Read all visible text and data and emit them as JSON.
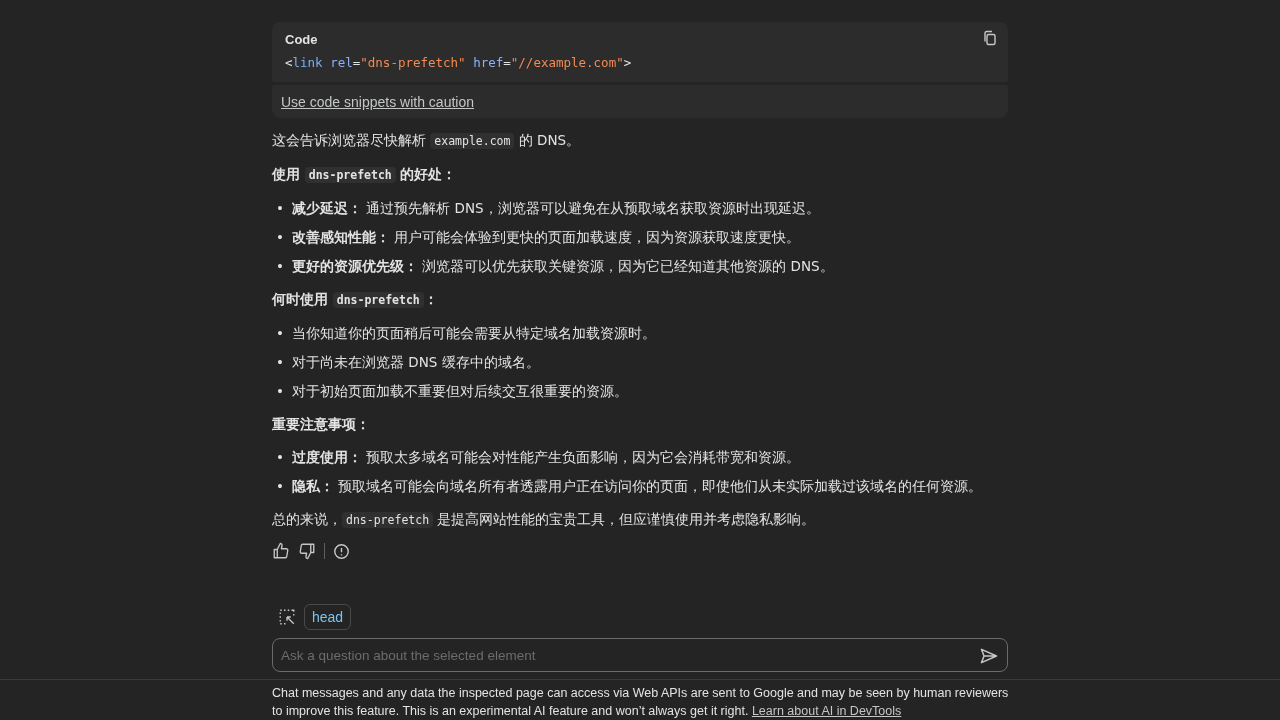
{
  "code_block": {
    "title": "Code",
    "tokens": [
      {
        "kind": "punct",
        "text": "<"
      },
      {
        "kind": "tag",
        "text": "link"
      },
      {
        "kind": "attr",
        "text": " rel"
      },
      {
        "kind": "punct",
        "text": "="
      },
      {
        "kind": "value",
        "text": "\"dns-prefetch\""
      },
      {
        "kind": "attr",
        "text": " href"
      },
      {
        "kind": "punct",
        "text": "="
      },
      {
        "kind": "value",
        "text": "\"//example.com\""
      },
      {
        "kind": "punct",
        "text": ">"
      }
    ],
    "caution_link": "Use code snippets with caution"
  },
  "bullet": "•",
  "blocks": [
    {
      "kind": "paragraph",
      "segments": [
        {
          "kind": "text",
          "text": "这会告诉浏览器尽快解析 "
        },
        {
          "kind": "code",
          "text": "example.com"
        },
        {
          "kind": "text",
          "text": " 的 DNS。"
        }
      ]
    },
    {
      "kind": "heading",
      "segments": [
        {
          "kind": "text",
          "text": "使用 "
        },
        {
          "kind": "code",
          "text": "dns-prefetch"
        },
        {
          "kind": "text",
          "text": " 的好处："
        }
      ]
    },
    {
      "kind": "list",
      "items": [
        [
          {
            "kind": "bold",
            "text": "减少延迟："
          },
          {
            "kind": "text",
            "text": " 通过预先解析 DNS，浏览器可以避免在从预取域名获取资源时出现延迟。"
          }
        ],
        [
          {
            "kind": "bold",
            "text": "改善感知性能："
          },
          {
            "kind": "text",
            "text": " 用户可能会体验到更快的页面加载速度，因为资源获取速度更快。"
          }
        ],
        [
          {
            "kind": "bold",
            "text": "更好的资源优先级："
          },
          {
            "kind": "text",
            "text": " 浏览器可以优先获取关键资源，因为它已经知道其他资源的 DNS。"
          }
        ]
      ]
    },
    {
      "kind": "heading",
      "segments": [
        {
          "kind": "text",
          "text": "何时使用 "
        },
        {
          "kind": "code",
          "text": "dns-prefetch"
        },
        {
          "kind": "text",
          "text": "："
        }
      ]
    },
    {
      "kind": "list",
      "items": [
        [
          {
            "kind": "text",
            "text": "当你知道你的页面稍后可能会需要从特定域名加载资源时。"
          }
        ],
        [
          {
            "kind": "text",
            "text": "对于尚未在浏览器 DNS 缓存中的域名。"
          }
        ],
        [
          {
            "kind": "text",
            "text": "对于初始页面加载不重要但对后续交互很重要的资源。"
          }
        ]
      ]
    },
    {
      "kind": "heading",
      "segments": [
        {
          "kind": "text",
          "text": "重要注意事项："
        }
      ]
    },
    {
      "kind": "list",
      "items": [
        [
          {
            "kind": "bold",
            "text": "过度使用："
          },
          {
            "kind": "text",
            "text": " 预取太多域名可能会对性能产生负面影响，因为它会消耗带宽和资源。"
          }
        ],
        [
          {
            "kind": "bold",
            "text": "隐私："
          },
          {
            "kind": "text",
            "text": " 预取域名可能会向域名所有者透露用户正在访问你的页面，即使他们从未实际加载过该域名的任何资源。"
          }
        ]
      ]
    },
    {
      "kind": "paragraph",
      "segments": [
        {
          "kind": "text",
          "text": "总的来说，"
        },
        {
          "kind": "code",
          "text": "dns-prefetch"
        },
        {
          "kind": "text",
          "text": " 是提高网站性能的宝贵工具，但应谨慎使用并考虑隐私影响。"
        }
      ]
    }
  ],
  "context_chip": "head",
  "input": {
    "placeholder": "Ask a question about the selected element"
  },
  "disclaimer": {
    "text": "Chat messages and any data the inspected page can access via Web APIs are sent to Google and may be seen by human reviewers to improve this feature. This is an experimental AI feature and won’t always get it right. ",
    "link": "Learn about AI in DevTools"
  }
}
